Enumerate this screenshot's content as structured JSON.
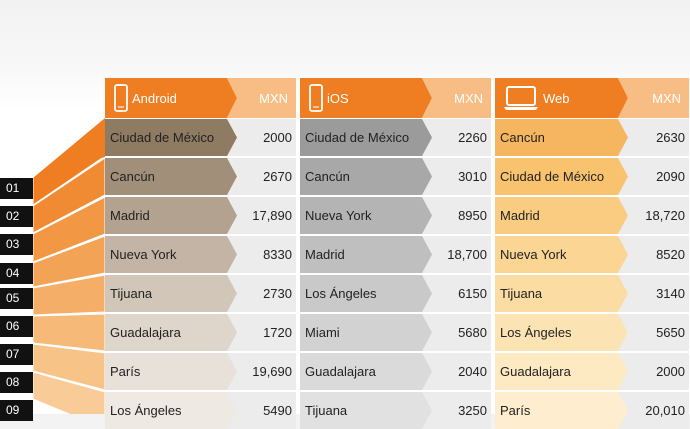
{
  "headers": [
    {
      "platform": "Android",
      "currency": "MXN",
      "icon": "phone-icon"
    },
    {
      "platform": "iOS",
      "currency": "MXN",
      "icon": "phone-icon"
    },
    {
      "platform": "Web",
      "currency": "MXN",
      "icon": "laptop-icon"
    }
  ],
  "ranks": [
    "01",
    "02",
    "03",
    "04",
    "05",
    "06",
    "07",
    "08",
    "09"
  ],
  "columns": [
    {
      "name": "android",
      "rows": [
        {
          "city": "Ciudad de México",
          "value": "2000"
        },
        {
          "city": "Cancún",
          "value": "2670"
        },
        {
          "city": "Madrid",
          "value": "17,890"
        },
        {
          "city": "Nueva York",
          "value": "8330"
        },
        {
          "city": "Tijuana",
          "value": "2730"
        },
        {
          "city": "Guadalajara",
          "value": "1720"
        },
        {
          "city": "París",
          "value": "19,690"
        },
        {
          "city": "Los Ángeles",
          "value": "5490"
        }
      ]
    },
    {
      "name": "ios",
      "rows": [
        {
          "city": "Ciudad de México",
          "value": "2260"
        },
        {
          "city": "Cancún",
          "value": "3010"
        },
        {
          "city": "Nueva York",
          "value": "8950"
        },
        {
          "city": "Madrid",
          "value": "18,700"
        },
        {
          "city": "Los Ángeles",
          "value": "6150"
        },
        {
          "city": "Miami",
          "value": "5680"
        },
        {
          "city": "Guadalajara",
          "value": "2040"
        },
        {
          "city": "Tijuana",
          "value": "3250"
        }
      ]
    },
    {
      "name": "web",
      "rows": [
        {
          "city": "Cancún",
          "value": "2630"
        },
        {
          "city": "Ciudad de México",
          "value": "2090"
        },
        {
          "city": "Madrid",
          "value": "18,720"
        },
        {
          "city": "Nueva York",
          "value": "8520"
        },
        {
          "city": "Tijuana",
          "value": "3140"
        },
        {
          "city": "Los Ángeles",
          "value": "5650"
        },
        {
          "city": "Guadalajara",
          "value": "2000"
        },
        {
          "city": "París",
          "value": "20,010"
        }
      ]
    }
  ],
  "colors": {
    "header_orange": "#ef7d21",
    "header_mxn": "#f8bd84",
    "android_fades": [
      "#8f7a62",
      "#a28f79",
      "#b3a290",
      "#c3b4a5",
      "#d2c6b9",
      "#ded5cb",
      "#e8e1da",
      "#efe9e3"
    ],
    "ios_fades": [
      "#9b9b9b",
      "#a8a8a8",
      "#b4b4b4",
      "#bfbfbf",
      "#c9c9c9",
      "#d2d2d2",
      "#dadada",
      "#e1e1e1"
    ],
    "web_fades": [
      "#f6b65f",
      "#f8c26f",
      "#f9cc82",
      "#fad593",
      "#fbdda4",
      "#fce3b3",
      "#fde9c2",
      "#feeecf"
    ],
    "num_bg": "#ececec",
    "rank_bg": "#111111"
  }
}
